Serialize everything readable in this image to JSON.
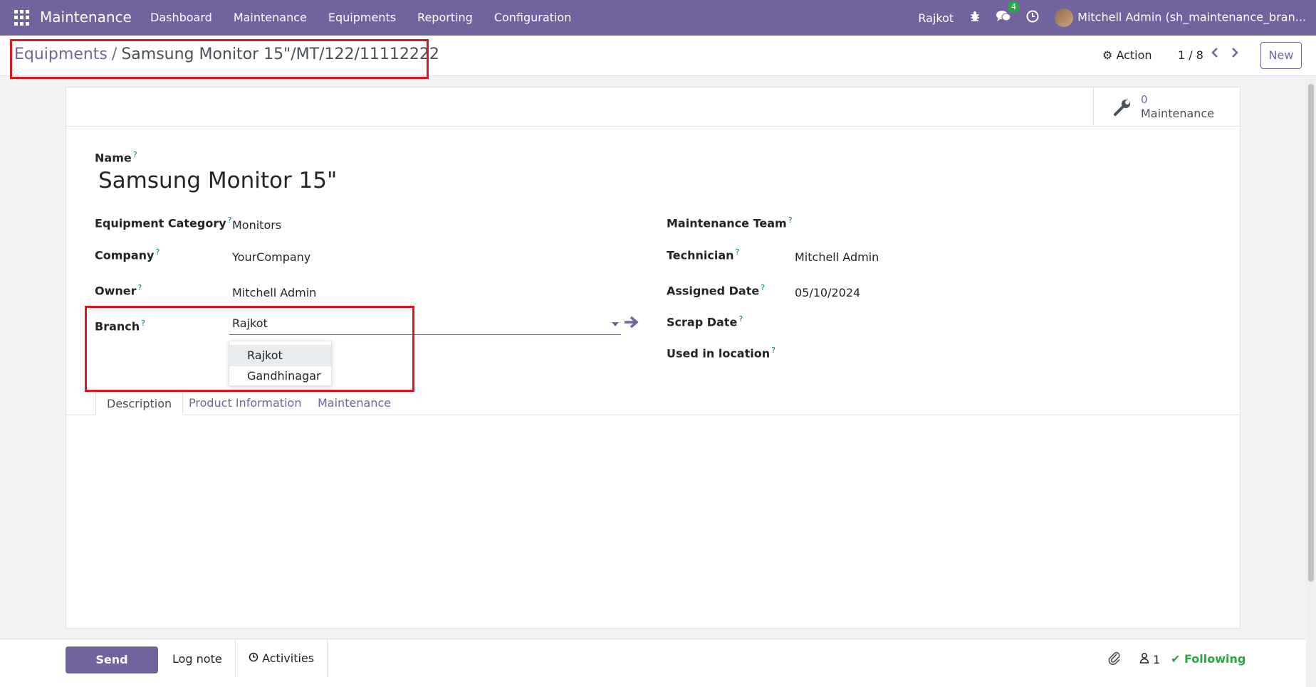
{
  "navbar": {
    "brand": "Maintenance",
    "menu": [
      "Dashboard",
      "Maintenance",
      "Equipments",
      "Reporting",
      "Configuration"
    ],
    "branch": "Rajkot",
    "chat_count": "4",
    "user": "Mitchell Admin (sh_maintenance_bran..."
  },
  "breadcrumb": {
    "parent": "Equipments",
    "separator": "/",
    "current": "Samsung Monitor 15\"/MT/122/11112222"
  },
  "control": {
    "action_label": "Action",
    "pager": "1 / 8",
    "new_label": "New"
  },
  "smart_button": {
    "count": "0",
    "label": "Maintenance"
  },
  "form": {
    "name_label": "Name",
    "name_value": "Samsung Monitor 15\"",
    "left": {
      "category_label": "Equipment Category",
      "category_value": "Monitors",
      "company_label": "Company",
      "company_value": "YourCompany",
      "owner_label": "Owner",
      "owner_value": "Mitchell Admin",
      "branch_label": "Branch",
      "branch_value": "Rajkot"
    },
    "right": {
      "team_label": "Maintenance Team",
      "technician_label": "Technician",
      "technician_value": "Mitchell Admin",
      "assigned_label": "Assigned Date",
      "assigned_value": "05/10/2024",
      "scrap_label": "Scrap Date",
      "location_label": "Used in location"
    },
    "help_mark": "?"
  },
  "dropdown": {
    "options": [
      "Rajkot",
      "Gandhinagar"
    ]
  },
  "tabs": [
    "Description",
    "Product Information",
    "Maintenance"
  ],
  "chatter": {
    "send_label": "Send message",
    "log_label": "Log note",
    "activities_label": "Activities",
    "followers_count": "1",
    "following_label": "Following"
  },
  "colors": {
    "brand": "#71639e",
    "highlight": "#e0141e",
    "success": "#28a745"
  }
}
